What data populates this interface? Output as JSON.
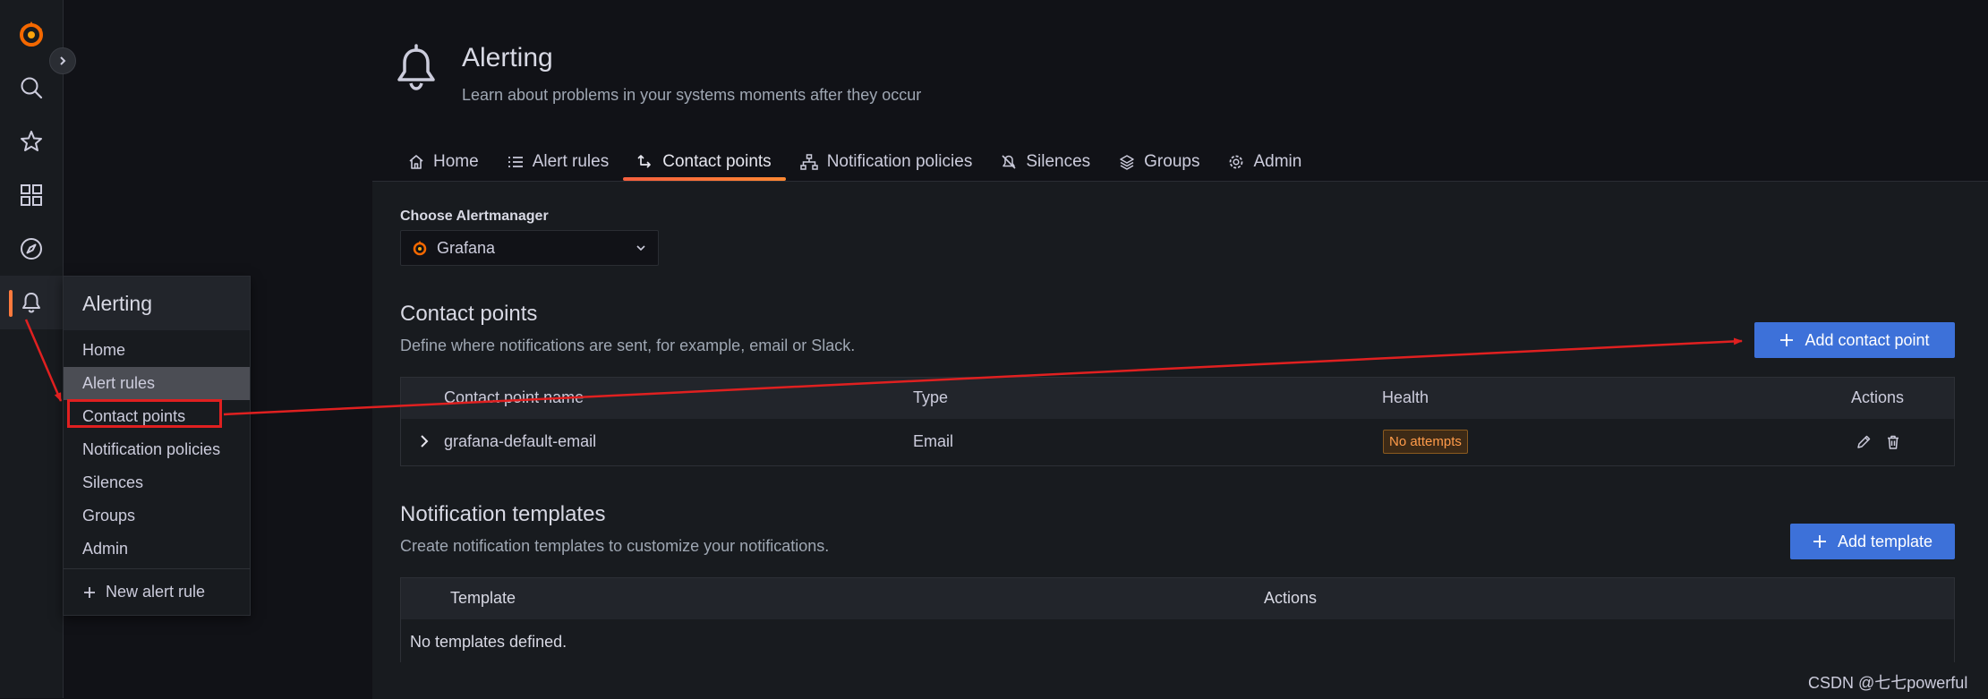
{
  "rail": {
    "items": [
      "grafana-logo",
      "search-icon",
      "star-icon",
      "dashboards-icon",
      "explore-icon",
      "bell-icon"
    ]
  },
  "flyout": {
    "title": "Alerting",
    "items": [
      {
        "label": "Home"
      },
      {
        "label": "Alert rules"
      },
      {
        "label": "Contact points"
      },
      {
        "label": "Notification policies"
      },
      {
        "label": "Silences"
      },
      {
        "label": "Groups"
      },
      {
        "label": "Admin"
      }
    ],
    "new_rule": "New alert rule"
  },
  "header": {
    "title": "Alerting",
    "subtitle": "Learn about problems in your systems moments after they occur"
  },
  "tabs": [
    {
      "label": "Home",
      "icon": "home-icon"
    },
    {
      "label": "Alert rules",
      "icon": "list-icon"
    },
    {
      "label": "Contact points",
      "icon": "contact-points-icon",
      "active": true
    },
    {
      "label": "Notification policies",
      "icon": "sitemap-icon"
    },
    {
      "label": "Silences",
      "icon": "bell-slash-icon"
    },
    {
      "label": "Groups",
      "icon": "layers-icon"
    },
    {
      "label": "Admin",
      "icon": "cog-icon"
    }
  ],
  "alertmanager": {
    "label": "Choose Alertmanager",
    "selected": "Grafana"
  },
  "contact_points": {
    "title": "Contact points",
    "description": "Define where notifications are sent, for example, email or Slack.",
    "add_button": "Add contact point",
    "columns": [
      "Contact point name",
      "Type",
      "Health",
      "Actions"
    ],
    "rows": [
      {
        "name": "grafana-default-email",
        "type": "Email",
        "health": "No attempts"
      }
    ]
  },
  "templates": {
    "title": "Notification templates",
    "description": "Create notification templates to customize your notifications.",
    "add_button": "Add template",
    "columns": [
      "Template",
      "Actions"
    ],
    "empty": "No templates defined."
  },
  "watermark": "CSDN @七七powerful",
  "colors": {
    "background": "#111217",
    "panel": "#181b1f",
    "primary": "#3d71d9",
    "active_tab": "#ff7a3d",
    "annotation": "#e02020",
    "health_badge": "#ff9b4a"
  }
}
